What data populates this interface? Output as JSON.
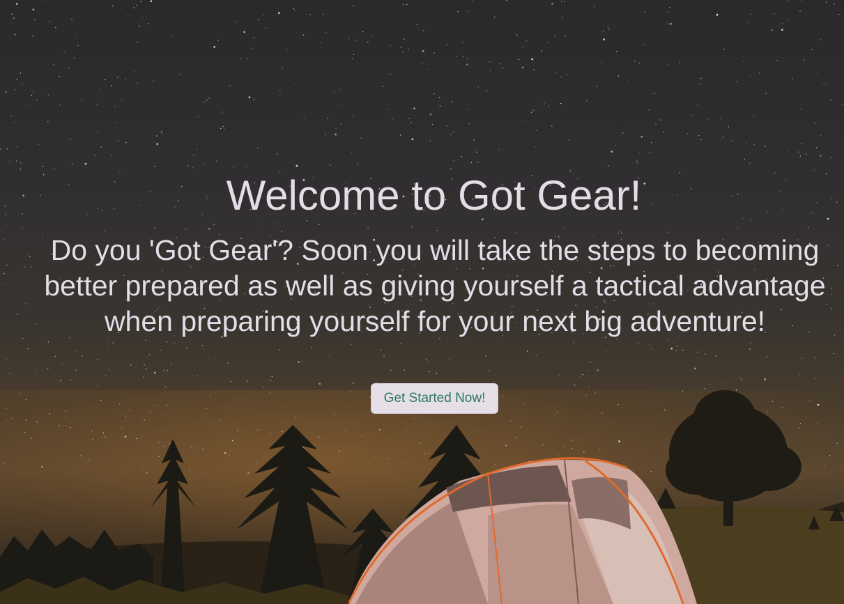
{
  "hero": {
    "title": "Welcome to Got Gear!",
    "subtitle": "Do you 'Got Gear'? Soon you will take the steps to becoming better prepared as well as giving yourself a tactical advantage when preparing yourself for your next big adventure!",
    "cta_label": "Get Started Now!",
    "background": "night-sky-camping-tent-photo"
  },
  "colors": {
    "text": "#e4dce6",
    "button_background": "#e6dfe8",
    "button_text": "#2e7a5e"
  }
}
